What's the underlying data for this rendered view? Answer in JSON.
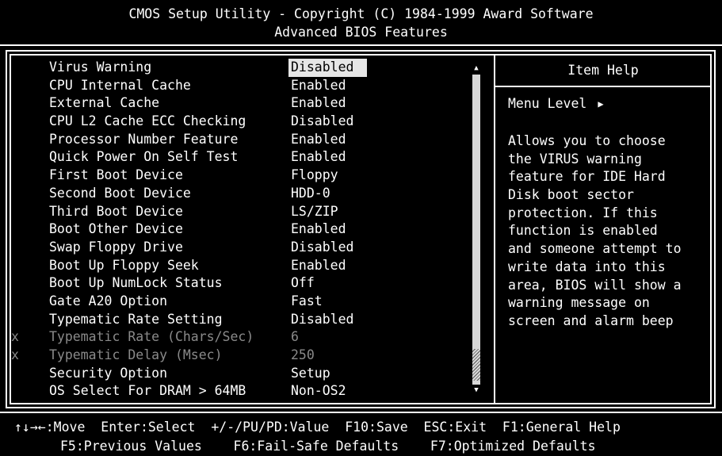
{
  "header": {
    "line1": "CMOS Setup Utility - Copyright (C) 1984-1999 Award Software",
    "line2": "Advanced BIOS Features"
  },
  "settings": [
    {
      "label": "Virus Warning",
      "value": "Disabled",
      "disabled": false,
      "selected": true
    },
    {
      "label": "CPU Internal Cache",
      "value": "Enabled",
      "disabled": false
    },
    {
      "label": "External Cache",
      "value": "Enabled",
      "disabled": false
    },
    {
      "label": "CPU L2 Cache ECC Checking",
      "value": "Disabled",
      "disabled": false
    },
    {
      "label": "Processor Number Feature",
      "value": "Enabled",
      "disabled": false
    },
    {
      "label": "Quick Power On Self Test",
      "value": "Enabled",
      "disabled": false
    },
    {
      "label": "First Boot Device",
      "value": "Floppy",
      "disabled": false
    },
    {
      "label": "Second Boot Device",
      "value": "HDD-0",
      "disabled": false
    },
    {
      "label": "Third Boot Device",
      "value": "LS/ZIP",
      "disabled": false
    },
    {
      "label": "Boot Other Device",
      "value": "Enabled",
      "disabled": false
    },
    {
      "label": "Swap Floppy Drive",
      "value": "Disabled",
      "disabled": false
    },
    {
      "label": "Boot Up Floppy Seek",
      "value": "Enabled",
      "disabled": false
    },
    {
      "label": "Boot Up NumLock Status",
      "value": "Off",
      "disabled": false
    },
    {
      "label": "Gate A20 Option",
      "value": "Fast",
      "disabled": false
    },
    {
      "label": "Typematic Rate Setting",
      "value": "Disabled",
      "disabled": false
    },
    {
      "label": "Typematic Rate (Chars/Sec)",
      "value": "6",
      "disabled": true,
      "marker": "x"
    },
    {
      "label": "Typematic Delay (Msec)",
      "value": "250",
      "disabled": true,
      "marker": "x"
    },
    {
      "label": "Security Option",
      "value": "Setup",
      "disabled": false
    },
    {
      "label": "OS Select For DRAM > 64MB",
      "value": "Non-OS2",
      "disabled": false
    }
  ],
  "help": {
    "title": "Item Help",
    "menu_level": "Menu Level",
    "lines": [
      "Allows you to choose",
      "the VIRUS warning",
      "feature for IDE Hard",
      "Disk boot sector",
      "protection. If this",
      "function is enabled",
      "and someone attempt to",
      "write data into this",
      "area, BIOS will show a",
      "warning message on",
      "screen and alarm beep"
    ]
  },
  "footer": {
    "line1": "↑↓→←:Move  Enter:Select  +/-/PU/PD:Value  F10:Save  ESC:Exit  F1:General Help",
    "line2": "F5:Previous Values    F6:Fail-Safe Defaults    F7:Optimized Defaults"
  }
}
